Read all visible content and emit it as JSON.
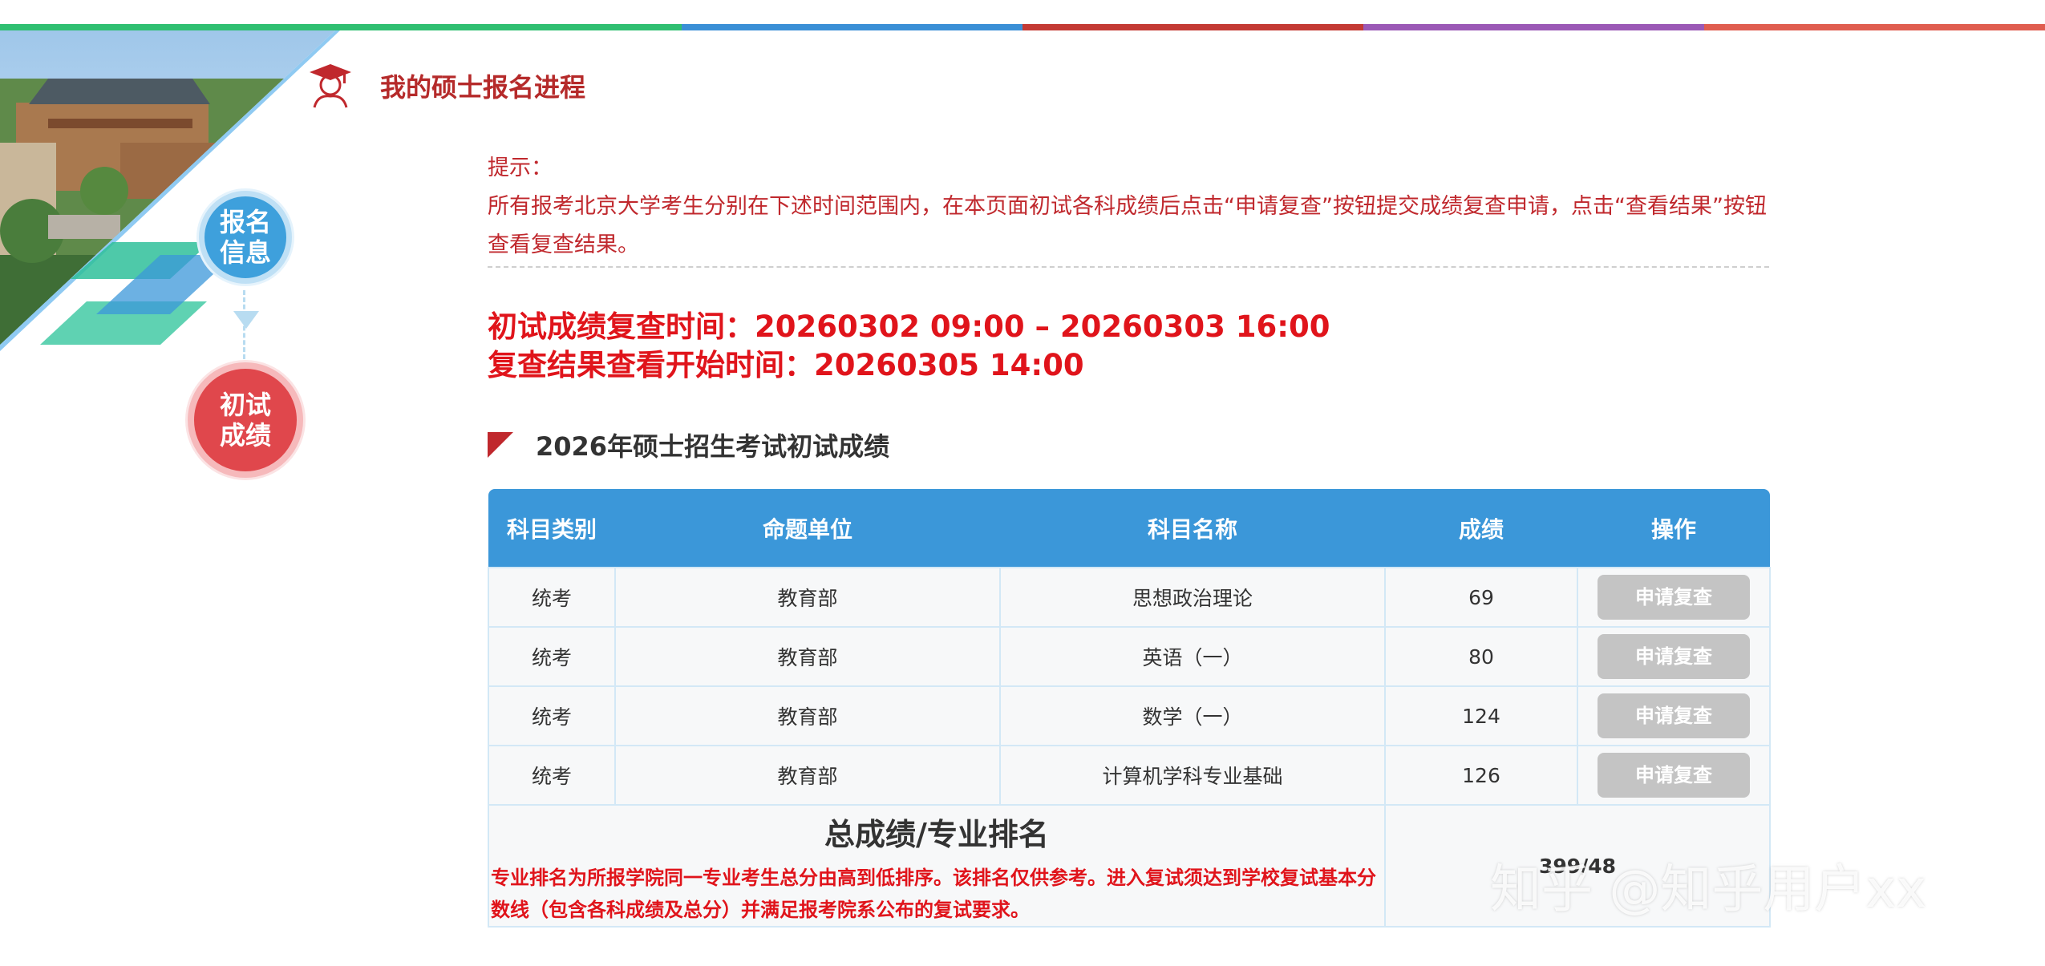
{
  "theme": {
    "stripe_colors": [
      "#2fbf71",
      "#2fbf71",
      "#3a8fd6",
      "#c43a34",
      "#9b59b6",
      "#e05d4f"
    ],
    "accent_red": "#c0282d",
    "table_header_blue": "#3b97d9"
  },
  "steps": [
    {
      "line1": "报名",
      "line2": "信息",
      "state": "done"
    },
    {
      "line1": "初试",
      "line2": "成绩",
      "state": "active"
    }
  ],
  "header": {
    "icon": "graduate-icon",
    "title": "我的硕士报名进程"
  },
  "notice": {
    "label": "提示：",
    "text": "所有报考北京大学考生分别在下述时间范围内，在本页面初试各科成绩后点击“申请复查”按钮提交成绩复查申请，点击“查看结果”按钮查看复查结果。"
  },
  "times": {
    "recheck_window": "初试成绩复查时间：20260302 09:00 – 20260303 16:00",
    "result_start": "复查结果查看开始时间：20260305 14:00"
  },
  "section": {
    "title": "2026年硕士招生考试初试成绩"
  },
  "table": {
    "headers": [
      "科目类别",
      "命题单位",
      "科目名称",
      "成绩",
      "操作"
    ],
    "rows": [
      {
        "category": "统考",
        "unit": "教育部",
        "subject": "思想政治理论",
        "score": "69",
        "action": "申请复查"
      },
      {
        "category": "统考",
        "unit": "教育部",
        "subject": "英语（一）",
        "score": "80",
        "action": "申请复查"
      },
      {
        "category": "统考",
        "unit": "教育部",
        "subject": "数学（一）",
        "score": "124",
        "action": "申请复查"
      },
      {
        "category": "统考",
        "unit": "教育部",
        "subject": "计算机学科专业基础",
        "score": "126",
        "action": "申请复查"
      }
    ],
    "total": {
      "title": "总成绩/专业排名",
      "note": "专业排名为所报学院同一专业考生总分由高到低排序。该排名仅供参考。进入复试须达到学校复试基本分数线（包含各科成绩及总分）并满足报考院系公布的复试要求。",
      "value": "399/48"
    }
  },
  "watermark": "知乎 @知乎用户xx"
}
